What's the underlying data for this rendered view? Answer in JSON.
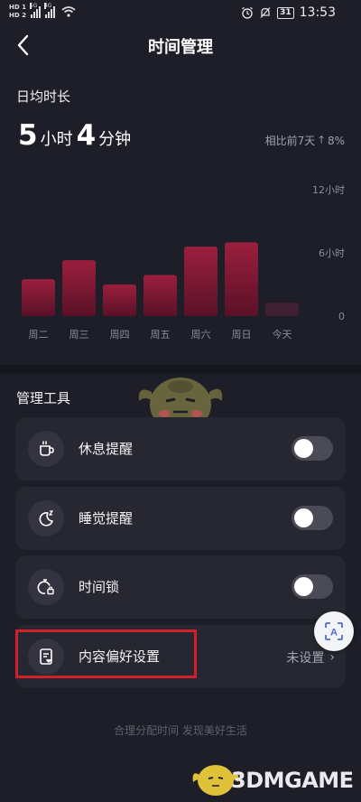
{
  "status_bar": {
    "hd1": "HD 1",
    "hd2": "HD 2",
    "net1": "5G",
    "net2": "4G",
    "battery": "31",
    "time": "13:53"
  },
  "header": {
    "title": "时间管理",
    "back_icon": "chevron-left-icon"
  },
  "summary": {
    "label": "日均时长",
    "hours": "5",
    "hours_unit": "小时",
    "minutes": "4",
    "minutes_unit": "分钟",
    "compare_label": "相比前7天",
    "compare_arrow": "up-arrow-icon",
    "compare_value": "8%"
  },
  "chart_data": {
    "type": "bar",
    "categories": [
      "周二",
      "周三",
      "周四",
      "周五",
      "周六",
      "周日",
      "今天"
    ],
    "values": [
      3.5,
      5.3,
      3.0,
      3.9,
      6.6,
      7.0,
      1.3
    ],
    "y_ticks": [
      "12小时",
      "6小时",
      "0"
    ],
    "ylim": [
      0,
      12
    ],
    "bar_color_top": "#9b1f3e",
    "bar_color_bottom": "#5a1127",
    "last_bar_color": "#3e2030",
    "grid": false
  },
  "tools": {
    "title": "管理工具",
    "items": [
      {
        "label": "休息提醒",
        "icon": "coffee-cup-icon",
        "toggle": false
      },
      {
        "label": "睡觉提醒",
        "icon": "moon-sleep-icon",
        "toggle": false
      },
      {
        "label": "时间锁",
        "icon": "timer-lock-icon",
        "toggle": false
      }
    ],
    "content_pref": {
      "label": "内容偏好设置",
      "icon": "content-heart-icon",
      "value": "未设置",
      "arrow": "chevron-right-icon"
    }
  },
  "floating": {
    "icon": "scan-text-icon",
    "glyph": "A"
  },
  "footer": {
    "slogan": "合理分配时间 发现美好生活"
  },
  "watermark": {
    "text": "3DMGAME"
  },
  "colors": {
    "background": "#1d1e27",
    "card": "#262731",
    "highlight": "#d1202a"
  }
}
